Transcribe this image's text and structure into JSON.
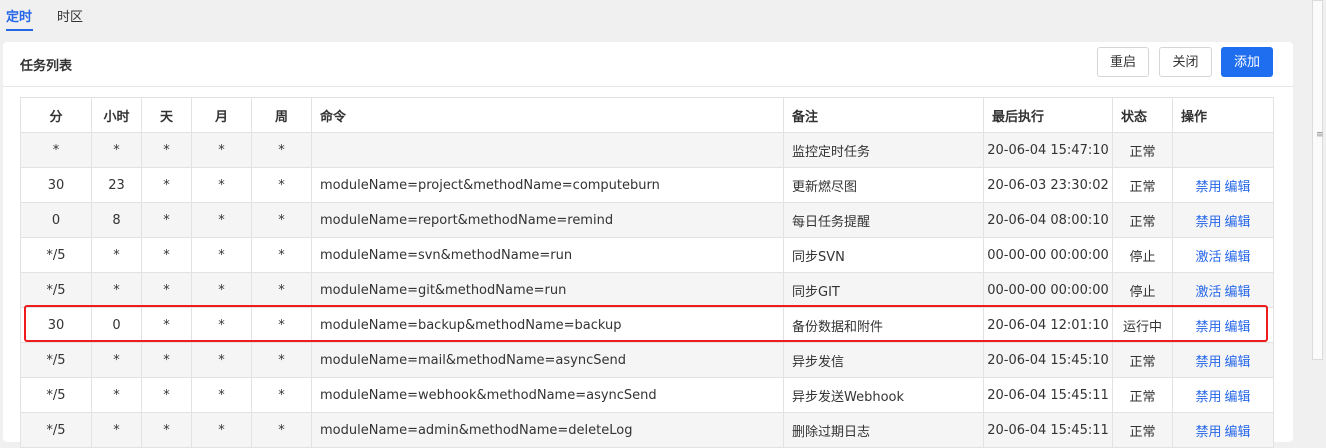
{
  "tabs": [
    {
      "label": "定时",
      "active": true
    },
    {
      "label": "时区",
      "active": false
    }
  ],
  "panel": {
    "title": "任务列表",
    "buttons": {
      "restart": "重启",
      "close": "关闭",
      "add": "添加"
    }
  },
  "table": {
    "headers": [
      "分",
      "小时",
      "天",
      "月",
      "周",
      "命令",
      "备注",
      "最后执行",
      "状态",
      "操作"
    ],
    "rows": [
      {
        "min": "*",
        "hour": "*",
        "day": "*",
        "month": "*",
        "week": "*",
        "command": "",
        "note": "监控定时任务",
        "last_run": "20-06-04 15:47:10",
        "status": "正常",
        "actions": []
      },
      {
        "min": "30",
        "hour": "23",
        "day": "*",
        "month": "*",
        "week": "*",
        "command": "moduleName=project&methodName=computeburn",
        "note": "更新燃尽图",
        "last_run": "20-06-03 23:30:02",
        "status": "正常",
        "actions": [
          "禁用",
          "编辑"
        ]
      },
      {
        "min": "0",
        "hour": "8",
        "day": "*",
        "month": "*",
        "week": "*",
        "command": "moduleName=report&methodName=remind",
        "note": "每日任务提醒",
        "last_run": "20-06-04 08:00:10",
        "status": "正常",
        "actions": [
          "禁用",
          "编辑"
        ]
      },
      {
        "min": "*/5",
        "hour": "*",
        "day": "*",
        "month": "*",
        "week": "*",
        "command": "moduleName=svn&methodName=run",
        "note": "同步SVN",
        "last_run": "00-00-00 00:00:00",
        "status": "停止",
        "actions": [
          "激活",
          "编辑"
        ]
      },
      {
        "min": "*/5",
        "hour": "*",
        "day": "*",
        "month": "*",
        "week": "*",
        "command": "moduleName=git&methodName=run",
        "note": "同步GIT",
        "last_run": "00-00-00 00:00:00",
        "status": "停止",
        "actions": [
          "激活",
          "编辑"
        ]
      },
      {
        "min": "30",
        "hour": "0",
        "day": "*",
        "month": "*",
        "week": "*",
        "command": "moduleName=backup&methodName=backup",
        "note": "备份数据和附件",
        "last_run": "20-06-04 12:01:10",
        "status": "运行中",
        "actions": [
          "禁用",
          "编辑"
        ]
      },
      {
        "min": "*/5",
        "hour": "*",
        "day": "*",
        "month": "*",
        "week": "*",
        "command": "moduleName=mail&methodName=asyncSend",
        "note": "异步发信",
        "last_run": "20-06-04 15:45:10",
        "status": "正常",
        "actions": [
          "禁用",
          "编辑"
        ]
      },
      {
        "min": "*/5",
        "hour": "*",
        "day": "*",
        "month": "*",
        "week": "*",
        "command": "moduleName=webhook&methodName=asyncSend",
        "note": "异步发送Webhook",
        "last_run": "20-06-04 15:45:11",
        "status": "正常",
        "actions": [
          "禁用",
          "编辑"
        ]
      },
      {
        "min": "*/5",
        "hour": "*",
        "day": "*",
        "month": "*",
        "week": "*",
        "command": "moduleName=admin&methodName=deleteLog",
        "note": "删除过期日志",
        "last_run": "20-06-04 15:45:11",
        "status": "正常",
        "actions": [
          "禁用",
          "编辑"
        ]
      }
    ]
  },
  "colors": {
    "accent": "#2667e8",
    "primary_button": "#1f6ef0",
    "highlight_border": "#ee1c1c"
  }
}
